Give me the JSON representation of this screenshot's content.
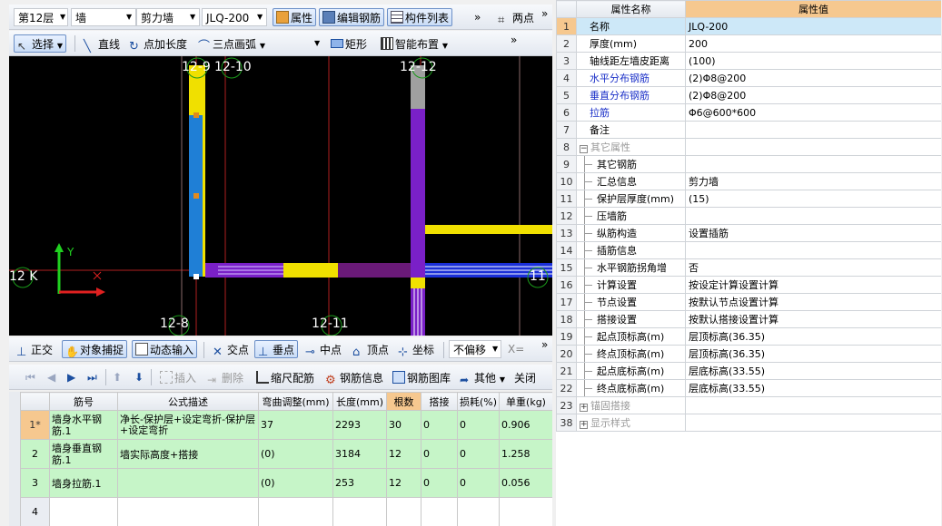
{
  "toolbar1": {
    "floor": "第12层",
    "type": "墙",
    "subtype": "剪力墙",
    "component": "JLQ-200",
    "btn_props": "属性",
    "btn_edit_rebar": "编辑钢筋",
    "btn_component_list": "构件列表",
    "btn_two_points": "两点",
    "more": "»"
  },
  "toolbar2": {
    "select": "选择",
    "line": "直线",
    "point_length": "点加长度",
    "three_arc": "三点画弧",
    "rect": "矩形",
    "smart_layout": "智能布置",
    "more": "»"
  },
  "canvas": {
    "labels": [
      "12-9",
      "12-10",
      "12-12",
      "12-8",
      "12-11",
      "12 K",
      "11"
    ],
    "axis_y": "Y",
    "axis_x": "X"
  },
  "snapbar": {
    "ortho": "正交",
    "snap": "对象捕捉",
    "dynamic_input": "动态输入",
    "intersection": "交点",
    "perpendicular": "垂点",
    "midpoint": "中点",
    "vertex": "顶点",
    "coord": "坐标",
    "no_offset": "不偏移",
    "x_label": "X=",
    "more": "»"
  },
  "rebar_toolbar": {
    "insert": "插入",
    "delete": "删除",
    "scale_rebar": "缩尺配筋",
    "rebar_info": "钢筋信息",
    "rebar_library": "钢筋图库",
    "other": "其他",
    "close": "关闭"
  },
  "rebar_table": {
    "headers": [
      "筋号",
      "公式描述",
      "弯曲调整(mm)",
      "长度(mm)",
      "根数",
      "搭接",
      "损耗(%)",
      "单重(kg)"
    ],
    "rows": [
      {
        "num": "1*",
        "name": "墙身水平钢筋.1",
        "formula": "净长-保护层+设定弯折-保护层+设定弯折",
        "bend": "37",
        "length": "2293",
        "count": "30",
        "lap": "0",
        "loss": "0",
        "weight": "0.906"
      },
      {
        "num": "2",
        "name": "墙身垂直钢筋.1",
        "formula": "墙实际高度+搭接",
        "bend": "(0)",
        "length": "3184",
        "count": "12",
        "lap": "0",
        "loss": "0",
        "weight": "1.258"
      },
      {
        "num": "3",
        "name": "墙身拉筋.1",
        "formula": "",
        "bend": "(0)",
        "length": "253",
        "count": "12",
        "lap": "0",
        "loss": "0",
        "weight": "0.056"
      },
      {
        "num": "4",
        "name": "",
        "formula": "",
        "bend": "",
        "length": "",
        "count": "",
        "lap": "",
        "loss": "",
        "weight": ""
      }
    ]
  },
  "props": {
    "header_name": "属性名称",
    "header_value": "属性值",
    "rows": [
      {
        "n": "1",
        "name": "名称",
        "value": "JLQ-200",
        "blue": false
      },
      {
        "n": "2",
        "name": "厚度(mm)",
        "value": "200",
        "blue": false
      },
      {
        "n": "3",
        "name": "轴线距左墙皮距离",
        "value": "(100)",
        "blue": false
      },
      {
        "n": "4",
        "name": "水平分布钢筋",
        "value": "(2)Φ8@200",
        "blue": true
      },
      {
        "n": "5",
        "name": "垂直分布钢筋",
        "value": "(2)Φ8@200",
        "blue": true
      },
      {
        "n": "6",
        "name": "拉筋",
        "value": "Φ6@600*600",
        "blue": true
      },
      {
        "n": "7",
        "name": "备注",
        "value": "",
        "blue": false
      },
      {
        "n": "8",
        "name": "其它属性",
        "value": "",
        "blue": false
      },
      {
        "n": "9",
        "name": "其它钢筋",
        "value": "",
        "blue": false
      },
      {
        "n": "10",
        "name": "汇总信息",
        "value": "剪力墙",
        "blue": false
      },
      {
        "n": "11",
        "name": "保护层厚度(mm)",
        "value": "(15)",
        "blue": false
      },
      {
        "n": "12",
        "name": "压墙筋",
        "value": "",
        "blue": false
      },
      {
        "n": "13",
        "name": "纵筋构造",
        "value": "设置插筋",
        "blue": false
      },
      {
        "n": "14",
        "name": "插筋信息",
        "value": "",
        "blue": false
      },
      {
        "n": "15",
        "name": "水平钢筋拐角增",
        "value": "否",
        "blue": false
      },
      {
        "n": "16",
        "name": "计算设置",
        "value": "按设定计算设置计算",
        "blue": false
      },
      {
        "n": "17",
        "name": "节点设置",
        "value": "按默认节点设置计算",
        "blue": false
      },
      {
        "n": "18",
        "name": "搭接设置",
        "value": "按默认搭接设置计算",
        "blue": false
      },
      {
        "n": "19",
        "name": "起点顶标高(m)",
        "value": "层顶标高(36.35)",
        "blue": false
      },
      {
        "n": "20",
        "name": "终点顶标高(m)",
        "value": "层顶标高(36.35)",
        "blue": false
      },
      {
        "n": "21",
        "name": "起点底标高(m)",
        "value": "层底标高(33.55)",
        "blue": false
      },
      {
        "n": "22",
        "name": "终点底标高(m)",
        "value": "层底标高(33.55)",
        "blue": false
      },
      {
        "n": "23",
        "name": "锚固搭接",
        "value": "",
        "blue": false
      },
      {
        "n": "38",
        "name": "显示样式",
        "value": "",
        "blue": false
      }
    ]
  }
}
